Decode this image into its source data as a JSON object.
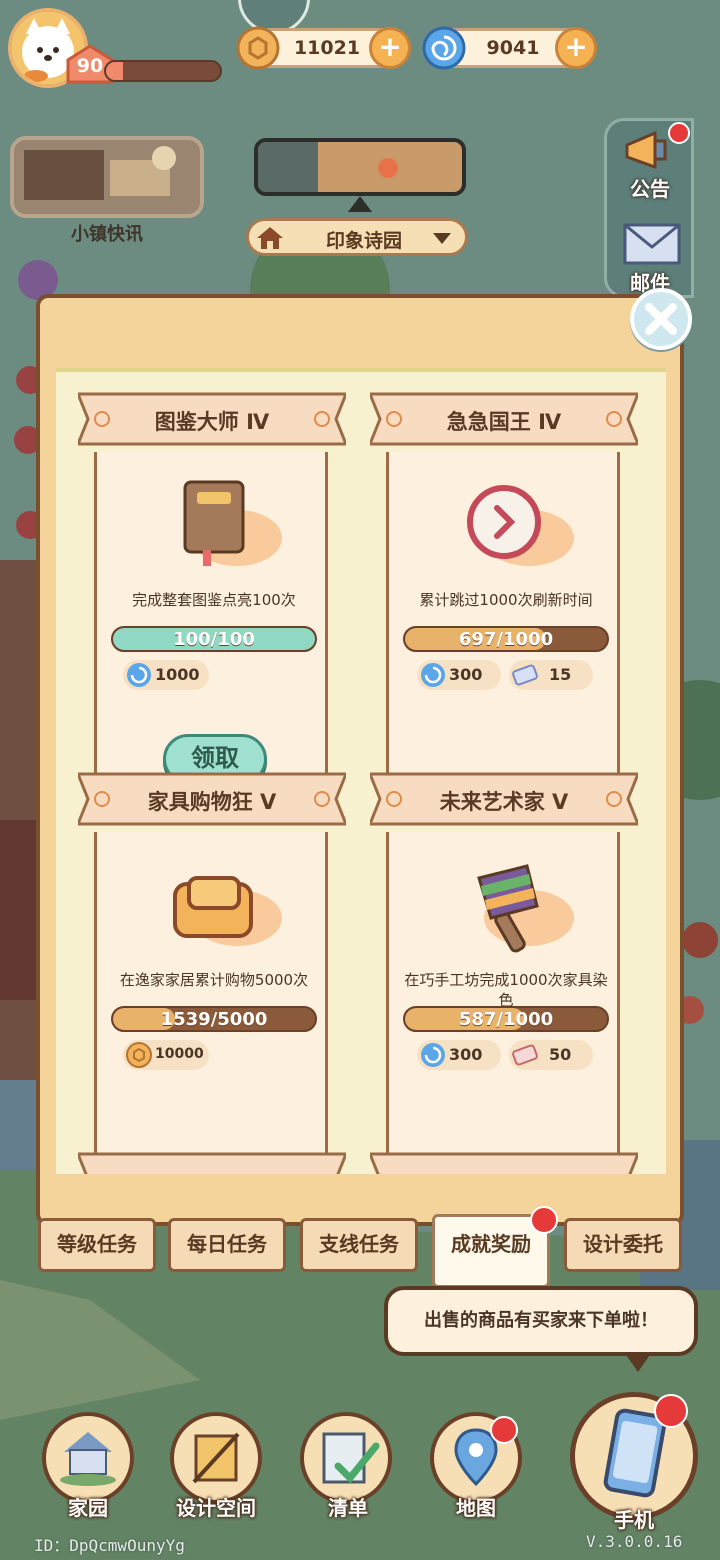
{
  "hud": {
    "level": "90",
    "level_progress": 0.15,
    "coins": "11021",
    "gems": "9041"
  },
  "town": {
    "news_label": "小镇快讯",
    "location_name": "印象诗园"
  },
  "side_menu": {
    "announcement": "公告",
    "mail": "邮件"
  },
  "achievements": [
    {
      "title": "图鉴大师 Ⅳ",
      "icon": "book-icon",
      "description": "完成整套图鉴点亮100次",
      "progress_text": "100/100",
      "progress": 1.0,
      "rewards": [
        {
          "icon": "gem-icon",
          "amount": "1000"
        }
      ],
      "claim_label": "领取"
    },
    {
      "title": "急急国王 Ⅳ",
      "icon": "clock-icon",
      "description": "累计跳过1000次刷新时间",
      "progress_text": "697/1000",
      "progress": 0.697,
      "rewards": [
        {
          "icon": "gem-icon",
          "amount": "300"
        },
        {
          "icon": "ticket-icon",
          "amount": "15"
        }
      ]
    },
    {
      "title": "家具购物狂 Ⅴ",
      "icon": "sofa-icon",
      "description": "在逸家家居累计购物5000次",
      "progress_text": "1539/5000",
      "progress": 0.3078,
      "rewards": [
        {
          "icon": "coin-icon",
          "amount": "10000"
        }
      ]
    },
    {
      "title": "未来艺术家 Ⅴ",
      "icon": "paintbrush-icon",
      "description": "在巧手工坊完成1000次家具染色",
      "progress_text": "587/1000",
      "progress": 0.587,
      "rewards": [
        {
          "icon": "gem-icon",
          "amount": "300"
        },
        {
          "icon": "ticket-icon",
          "amount": "50"
        }
      ]
    }
  ],
  "tabs": [
    "等级任务",
    "每日任务",
    "支线任务",
    "成就奖励",
    "设计委托"
  ],
  "active_tab": "成就奖励",
  "toast": "出售的商品有买家来下单啦！",
  "bottom_nav": [
    "家园",
    "设计空间",
    "清单",
    "地图",
    "手机"
  ],
  "footer": {
    "id": "ID：DpQcmwOunyYg",
    "version": "V.3.0.0.16"
  },
  "colors": {
    "progress_complete": "#8fd9c4",
    "progress_partial": "#e8b26a",
    "badge_red": "#e63a3a"
  }
}
